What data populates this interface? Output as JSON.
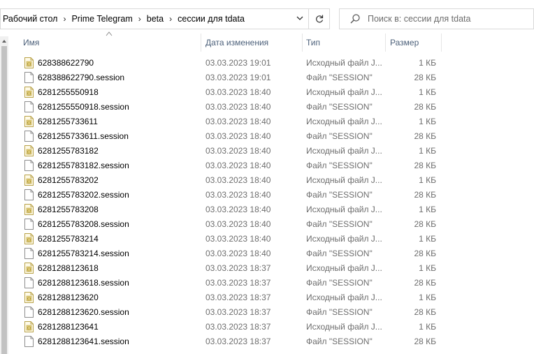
{
  "address_bar": {
    "breadcrumbs": [
      "Рабочий стол",
      "Prime Telegram",
      "beta",
      "сессии для tdata"
    ]
  },
  "search": {
    "placeholder": "Поиск в: сессии для tdata"
  },
  "columns": {
    "name": "Имя",
    "date": "Дата изменения",
    "type": "Тип",
    "size": "Размер"
  },
  "files": [
    {
      "name": "628388622790",
      "date": "03.03.2023 19:01",
      "type": "Исходный файл J...",
      "size": "1 КБ",
      "icon": "json-file-icon"
    },
    {
      "name": "628388622790.session",
      "date": "03.03.2023 19:01",
      "type": "Файл \"SESSION\"",
      "size": "28 КБ",
      "icon": "session-file-icon"
    },
    {
      "name": "6281255550918",
      "date": "03.03.2023 18:40",
      "type": "Исходный файл J...",
      "size": "1 КБ",
      "icon": "json-file-icon"
    },
    {
      "name": "6281255550918.session",
      "date": "03.03.2023 18:40",
      "type": "Файл \"SESSION\"",
      "size": "28 КБ",
      "icon": "session-file-icon"
    },
    {
      "name": "6281255733611",
      "date": "03.03.2023 18:40",
      "type": "Исходный файл J...",
      "size": "1 КБ",
      "icon": "json-file-icon"
    },
    {
      "name": "6281255733611.session",
      "date": "03.03.2023 18:40",
      "type": "Файл \"SESSION\"",
      "size": "28 КБ",
      "icon": "session-file-icon"
    },
    {
      "name": "6281255783182",
      "date": "03.03.2023 18:40",
      "type": "Исходный файл J...",
      "size": "1 КБ",
      "icon": "json-file-icon"
    },
    {
      "name": "6281255783182.session",
      "date": "03.03.2023 18:40",
      "type": "Файл \"SESSION\"",
      "size": "28 КБ",
      "icon": "session-file-icon"
    },
    {
      "name": "6281255783202",
      "date": "03.03.2023 18:40",
      "type": "Исходный файл J...",
      "size": "1 КБ",
      "icon": "json-file-icon"
    },
    {
      "name": "6281255783202.session",
      "date": "03.03.2023 18:40",
      "type": "Файл \"SESSION\"",
      "size": "28 КБ",
      "icon": "session-file-icon"
    },
    {
      "name": "6281255783208",
      "date": "03.03.2023 18:40",
      "type": "Исходный файл J...",
      "size": "1 КБ",
      "icon": "json-file-icon"
    },
    {
      "name": "6281255783208.session",
      "date": "03.03.2023 18:40",
      "type": "Файл \"SESSION\"",
      "size": "28 КБ",
      "icon": "session-file-icon"
    },
    {
      "name": "6281255783214",
      "date": "03.03.2023 18:40",
      "type": "Исходный файл J...",
      "size": "1 КБ",
      "icon": "json-file-icon"
    },
    {
      "name": "6281255783214.session",
      "date": "03.03.2023 18:40",
      "type": "Файл \"SESSION\"",
      "size": "28 КБ",
      "icon": "session-file-icon"
    },
    {
      "name": "6281288123618",
      "date": "03.03.2023 18:37",
      "type": "Исходный файл J...",
      "size": "1 КБ",
      "icon": "json-file-icon"
    },
    {
      "name": "6281288123618.session",
      "date": "03.03.2023 18:37",
      "type": "Файл \"SESSION\"",
      "size": "28 КБ",
      "icon": "session-file-icon"
    },
    {
      "name": "6281288123620",
      "date": "03.03.2023 18:37",
      "type": "Исходный файл J...",
      "size": "1 КБ",
      "icon": "json-file-icon"
    },
    {
      "name": "6281288123620.session",
      "date": "03.03.2023 18:37",
      "type": "Файл \"SESSION\"",
      "size": "28 КБ",
      "icon": "session-file-icon"
    },
    {
      "name": "6281288123641",
      "date": "03.03.2023 18:37",
      "type": "Исходный файл J...",
      "size": "1 КБ",
      "icon": "json-file-icon"
    },
    {
      "name": "6281288123641.session",
      "date": "03.03.2023 18:37",
      "type": "Файл \"SESSION\"",
      "size": "28 КБ",
      "icon": "session-file-icon"
    }
  ],
  "colors": {
    "header_text": "#4c607a",
    "secondary_text": "#6d6d6d",
    "json_icon": "#d9c46a"
  }
}
